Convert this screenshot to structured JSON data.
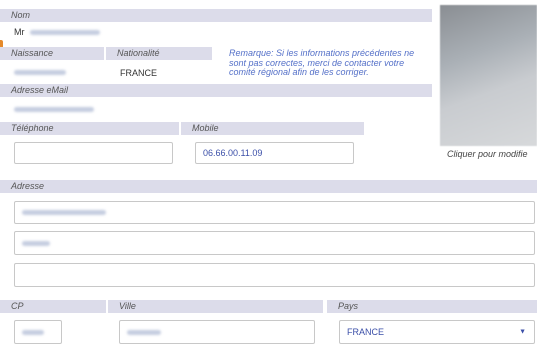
{
  "labels": {
    "nom": "Nom",
    "naissance": "Naissance",
    "nationalite": "Nationalité",
    "adresse_email": "Adresse eMail",
    "telephone": "Téléphone",
    "mobile": "Mobile",
    "adresse": "Adresse",
    "cp": "CP",
    "ville": "Ville",
    "pays": "Pays"
  },
  "values": {
    "civilite": "Mr",
    "nationalite": "FRANCE",
    "mobile": "06.66.00.11.09",
    "telephone": "",
    "adresse_line3": "",
    "pays": "FRANCE"
  },
  "note": "Remarque: Si les informations précédentes ne sont pas correctes, merci de contacter votre comité régional afin de les corriger.",
  "photo": {
    "caption": "Cliquer pour modifie"
  },
  "icons": {
    "select_arrow": "chevron-down-icon"
  },
  "colors": {
    "header_bg": "#dcdcea",
    "link_blue": "#5470c8",
    "input_text": "#3b4fa8"
  }
}
